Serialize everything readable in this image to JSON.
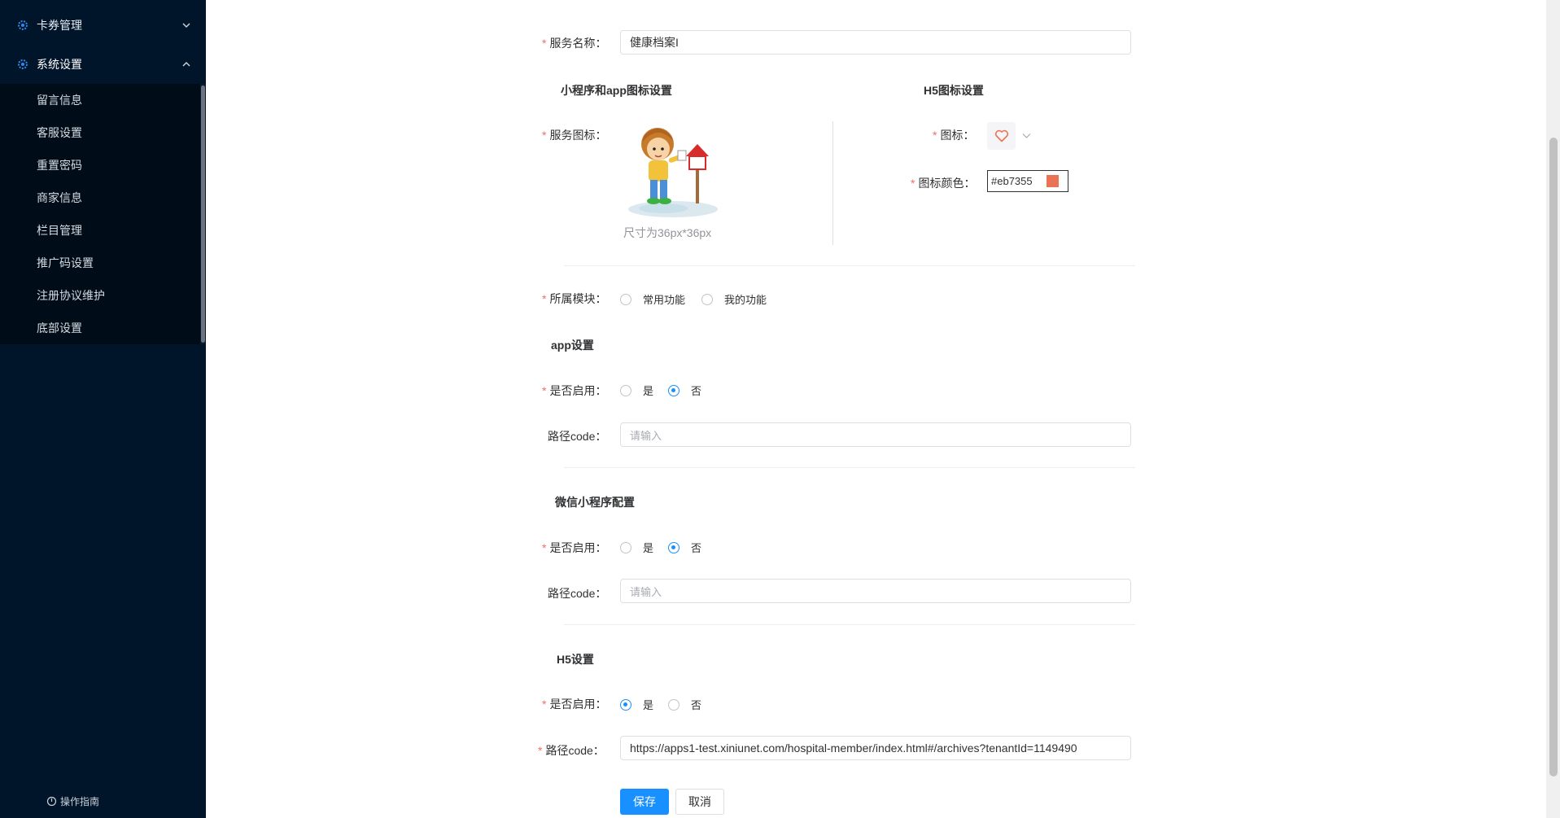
{
  "sidebar": {
    "top_items": [
      {
        "label": "卡券管理",
        "icon": "gear-icon",
        "expanded": false
      },
      {
        "label": "系统设置",
        "icon": "gear-icon",
        "expanded": true
      }
    ],
    "sub_items": [
      {
        "label": "留言信息"
      },
      {
        "label": "客服设置"
      },
      {
        "label": "重置密码"
      },
      {
        "label": "商家信息"
      },
      {
        "label": "栏目管理"
      },
      {
        "label": "推广码设置"
      },
      {
        "label": "注册协议维护"
      },
      {
        "label": "底部设置"
      }
    ],
    "guide_label": "操作指南"
  },
  "form": {
    "service_name": {
      "label": "服务名称：",
      "value": "健康档案I"
    },
    "mini_app_icon_section": "小程序和app图标设置",
    "h5_icon_section": "H5图标设置",
    "service_icon": {
      "label": "服务图标：",
      "hint": "尺寸为36px*36px"
    },
    "h5_icon": {
      "label": "图标：",
      "icon": "heart-icon"
    },
    "h5_icon_color": {
      "label": "图标颜色：",
      "value": "#eb7355"
    },
    "module": {
      "label": "所属模块：",
      "options": [
        "常用功能",
        "我的功能"
      ],
      "selected": null
    },
    "app": {
      "title": "app设置",
      "enabled_label": "是否启用：",
      "options": [
        "是",
        "否"
      ],
      "selected": "否",
      "path_label": "路径code：",
      "path_placeholder": "请输入"
    },
    "wechat": {
      "title": "微信小程序配置",
      "enabled_label": "是否启用：",
      "options": [
        "是",
        "否"
      ],
      "selected": "否",
      "path_label": "路径code：",
      "path_placeholder": "请输入"
    },
    "h5": {
      "title": "H5设置",
      "enabled_label": "是否启用：",
      "options": [
        "是",
        "否"
      ],
      "selected": "是",
      "path_label": "路径code：",
      "path_value": "https://apps1-test.xiniunet.com/hospital-member/index.html#/archives?tenantId=1149490"
    },
    "save_label": "保存",
    "cancel_label": "取消"
  },
  "colors": {
    "sidebar_bg": "#001529",
    "accent": "#1890ff",
    "required": "#f56c6c",
    "icon_color": "#eb7355"
  }
}
